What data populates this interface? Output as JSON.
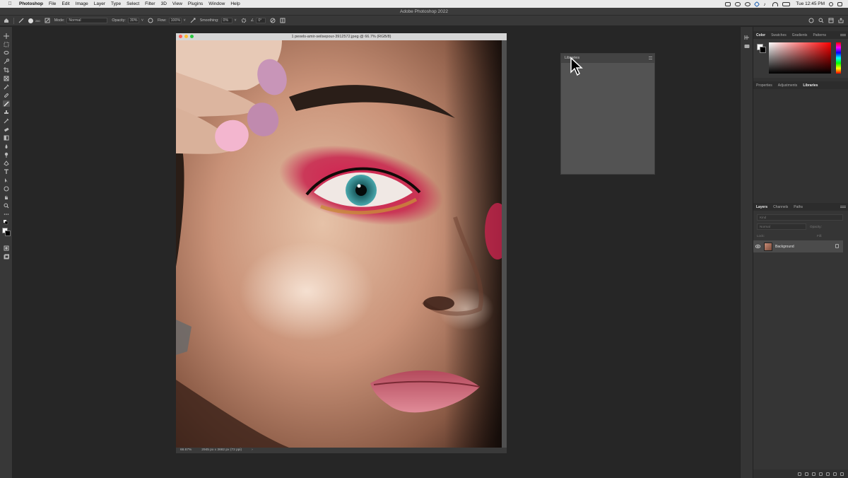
{
  "menubar": {
    "app": "Photoshop",
    "items": [
      "File",
      "Edit",
      "Image",
      "Layer",
      "Type",
      "Select",
      "Filter",
      "3D",
      "View",
      "Plugins",
      "Window",
      "Help"
    ],
    "clock": "Tue 12:45 PM"
  },
  "titlebar": {
    "title": "Adobe Photoshop 2022"
  },
  "options": {
    "brush_size": "280",
    "mode_label": "Mode:",
    "mode_value": "Normal",
    "opacity_label": "Opacity:",
    "opacity_value": "30%",
    "flow_label": "Flow:",
    "flow_value": "100%",
    "smoothing_label": "Smoothing:",
    "smoothing_value": "0%",
    "angle_value": "0°"
  },
  "document": {
    "tab_title": "1 pexels-amir-seilsepour-3912572.jpeg @ 66.7% (RGB/8)",
    "zoom": "66.67%",
    "doc_size": "2945 px x 3682 px (72 ppi)"
  },
  "libraries_panel": {
    "title": "Libraries"
  },
  "color_panel": {
    "tabs": [
      "Color",
      "Swatches",
      "Gradients",
      "Patterns"
    ],
    "active_tab": "Color",
    "hue_color": "#ff0000"
  },
  "props_panel": {
    "tabs": [
      "Properties",
      "Adjustments",
      "Libraries"
    ],
    "active_tab": "Libraries"
  },
  "layers_panel": {
    "tabs": [
      "Layers",
      "Channels",
      "Paths"
    ],
    "active_tab": "Layers",
    "kind_placeholder": "Kind",
    "blend_mode": "Normal",
    "opacity_label": "Opacity:",
    "lock_label": "Lock:",
    "fill_label": "Fill:",
    "layers": [
      {
        "name": "Background",
        "visible": true,
        "locked": true
      }
    ]
  }
}
